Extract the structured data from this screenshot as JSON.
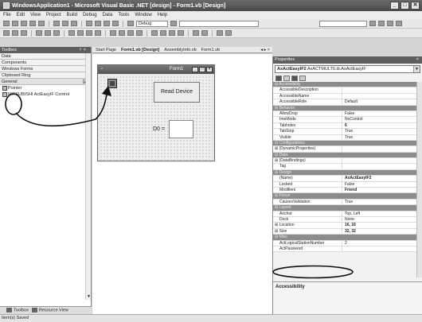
{
  "window": {
    "title": "WindowsApplication1 - Microsoft Visual Basic .NET [design] - Form1.vb [Design]"
  },
  "menu": [
    "File",
    "Edit",
    "View",
    "Project",
    "Build",
    "Debug",
    "Data",
    "Tools",
    "Window",
    "Help"
  ],
  "toolbar": {
    "config": "Debug"
  },
  "toolbox": {
    "title": "Toolbox",
    "categories": [
      "Data",
      "Components",
      "Windows Forms",
      "Clipboard Ring"
    ],
    "general": "General",
    "items": [
      "Pointer",
      "MITSUBISHI ActEasyIF Control"
    ]
  },
  "bottom_tabs": [
    "Toolbox",
    "Resource View"
  ],
  "status": "Item(s) Saved",
  "doc_tabs": [
    "Start Page",
    "Form1.vb [Design]",
    "AssemblyInfo.vb",
    "Form1.vb"
  ],
  "form": {
    "title": "Form1",
    "button": "Read Device",
    "d0_label": "D0 ="
  },
  "properties": {
    "title": "Properties",
    "object_name": "AxActEasyIF2",
    "object_type": "AxACTMULTILib.AxActEasyIF",
    "rows": [
      {
        "name": "Accessibility",
        "value": "",
        "kind": "cat"
      },
      {
        "name": "AccessibleDescription",
        "value": ""
      },
      {
        "name": "AccessibleName",
        "value": ""
      },
      {
        "name": "AccessibleRole",
        "value": "Default"
      },
      {
        "name": "Behavior",
        "value": "",
        "kind": "cat"
      },
      {
        "name": "AllowDrop",
        "value": "False"
      },
      {
        "name": "ImeMode",
        "value": "NoControl"
      },
      {
        "name": "TabIndex",
        "value": "6",
        "kind": "bold"
      },
      {
        "name": "TabStop",
        "value": "True"
      },
      {
        "name": "Visible",
        "value": "True"
      },
      {
        "name": "Configurations",
        "value": "",
        "kind": "cat"
      },
      {
        "name": "(DynamicProperties)",
        "value": "",
        "kind": "exp"
      },
      {
        "name": "Data",
        "value": "",
        "kind": "cat"
      },
      {
        "name": "(DataBindings)",
        "value": "",
        "kind": "exp"
      },
      {
        "name": "Tag",
        "value": ""
      },
      {
        "name": "Design",
        "value": "",
        "kind": "cat"
      },
      {
        "name": "(Name)",
        "value": "AxActEasyIF2",
        "kind": "bold"
      },
      {
        "name": "Locked",
        "value": "False"
      },
      {
        "name": "Modifiers",
        "value": "Friend",
        "kind": "bold"
      },
      {
        "name": "Focus",
        "value": "",
        "kind": "cat"
      },
      {
        "name": "CausesValidation",
        "value": "True"
      },
      {
        "name": "Layout",
        "value": "",
        "kind": "cat"
      },
      {
        "name": "Anchor",
        "value": "Top, Left"
      },
      {
        "name": "Dock",
        "value": "None"
      },
      {
        "name": "Location",
        "value": "16, 16",
        "kind": "expbold"
      },
      {
        "name": "Size",
        "value": "32, 32",
        "kind": "expbold"
      },
      {
        "name": "Misc",
        "value": "",
        "kind": "cat"
      },
      {
        "name": "ActLogicalStationNumber",
        "value": "2"
      },
      {
        "name": "ActPassword",
        "value": ""
      }
    ],
    "description": "Accessibility"
  }
}
